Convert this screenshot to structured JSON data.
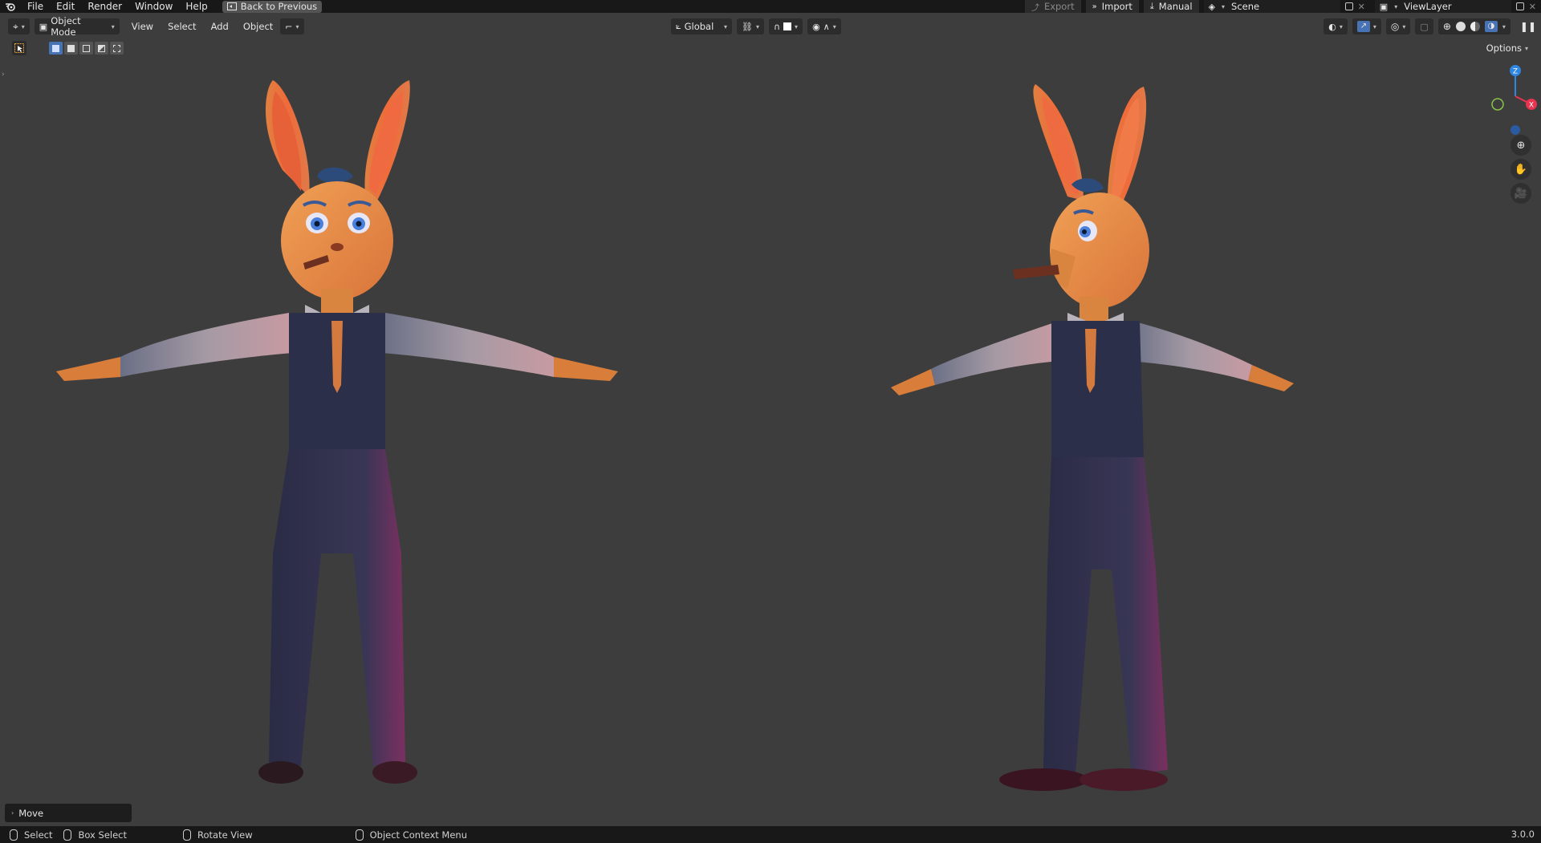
{
  "topbar": {
    "menus": [
      "File",
      "Edit",
      "Render",
      "Window",
      "Help"
    ],
    "back_label": "Back to Previous",
    "export_label": "Export",
    "import_label": "Import",
    "manual_label": "Manual",
    "scene_value": "Scene",
    "viewlayer_value": "ViewLayer"
  },
  "header": {
    "mode_label": "Object Mode",
    "menus": [
      "View",
      "Select",
      "Add",
      "Object"
    ],
    "transform_orientation": "Global"
  },
  "toolrow": {
    "options_label": "Options"
  },
  "viewport": {
    "gizmo": {
      "z": "Z",
      "x": "X"
    }
  },
  "last_operator": {
    "label": "Move"
  },
  "statusbar": {
    "select_label": "Select",
    "box_select_label": "Box Select",
    "rotate_label": "Rotate View",
    "context_menu_label": "Object Context Menu",
    "version": "3.0.0"
  },
  "colors": {
    "accent": "#4772b3",
    "axis_x": "#e8344f",
    "axis_y": "#8bc34a",
    "axis_z": "#2f86e0",
    "viewport_bg": "#3d3d3d",
    "header_bg": "#181818"
  }
}
